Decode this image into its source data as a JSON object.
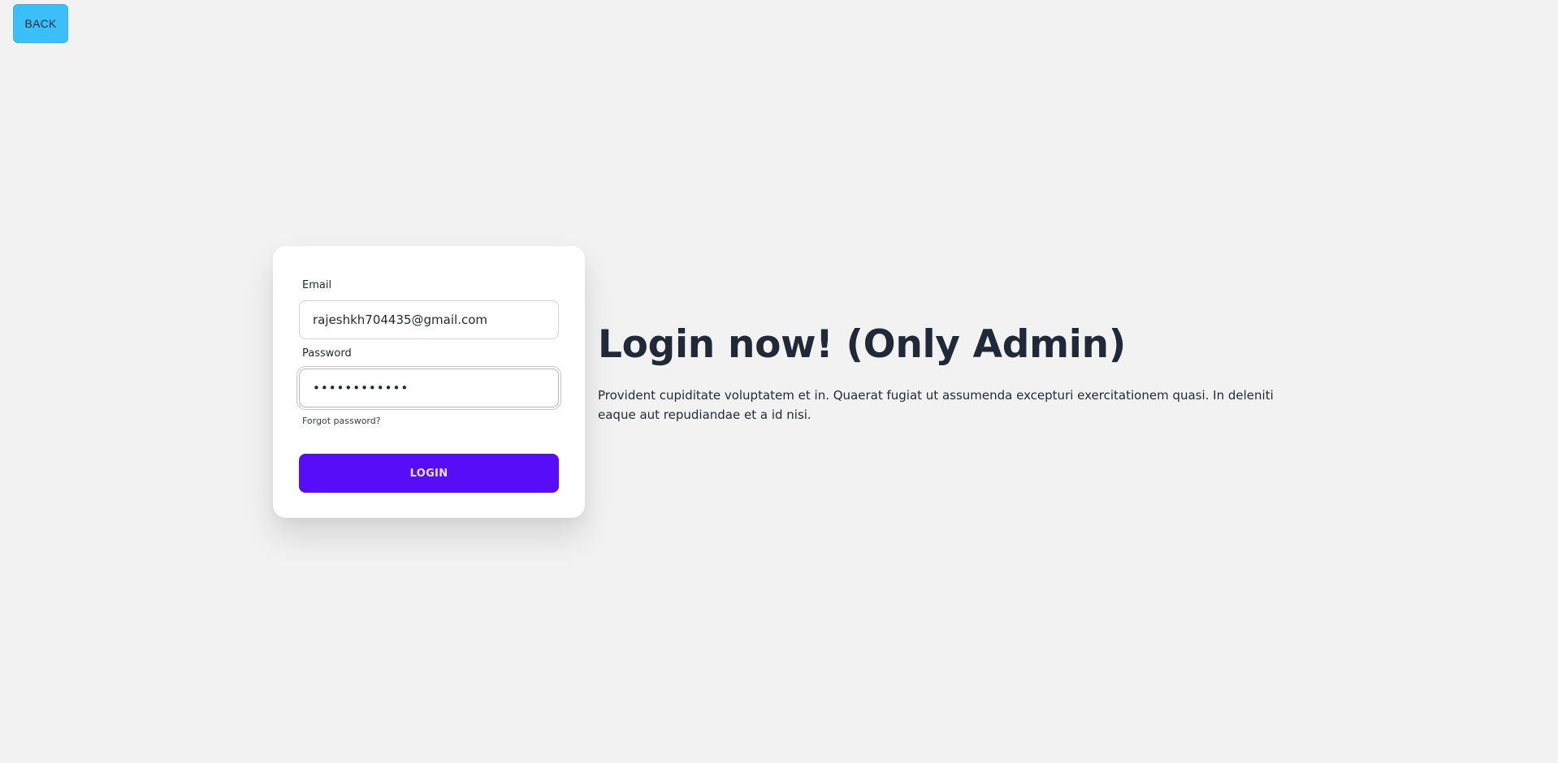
{
  "back_button": {
    "label": "BACK"
  },
  "login_form": {
    "email_label": "Email",
    "email_value": "rajeshkh704435@gmail.com",
    "password_label": "Password",
    "password_value": "••••••••••••",
    "forgot_password": "Forgot password?",
    "login_label": "LOGIN"
  },
  "hero": {
    "title": "Login now! (Only Admin)",
    "description": "Provident cupiditate voluptatem et in. Quaerat fugiat ut assumenda excepturi exercitationem quasi. In deleniti eaque aut repudiandae et a id nisi."
  },
  "colors": {
    "background": "#f2f2f2",
    "back_button": "#3abff8",
    "primary": "#570df8",
    "text": "#1f2937"
  }
}
